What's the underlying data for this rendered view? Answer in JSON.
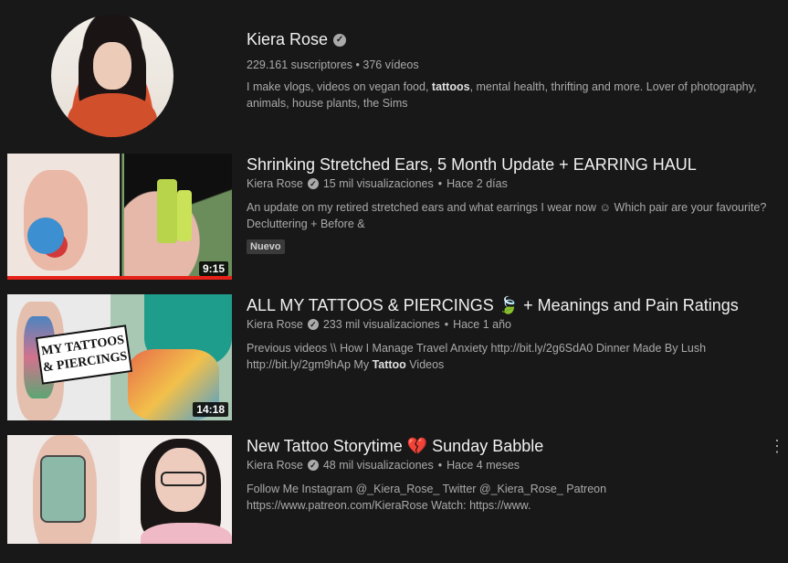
{
  "channel": {
    "name": "Kiera Rose",
    "subscribers": "229.161 suscriptores",
    "separator": "•",
    "videos": "376 vídeos",
    "description_pre": "I make vlogs, videos on vegan food, ",
    "description_bold": "tattoos",
    "description_post": ", mental health, thrifting and more. Lover of photography, animals, house plants, the Sims"
  },
  "videos": [
    {
      "title": "Shrinking Stretched Ears, 5 Month Update + EARRING HAUL",
      "channel": "Kiera Rose",
      "views": "15 mil visualizaciones",
      "age": "Hace 2 días",
      "description": "An update on my retired stretched ears and what earrings I wear now ☺ Which pair are your favourite? Decluttering + Before &",
      "badge": "Nuevo",
      "duration": "9:15",
      "watched_progress": 1.0
    },
    {
      "title": "ALL MY TATTOOS & PIERCINGS 🍃 + Meanings and Pain Ratings",
      "channel": "Kiera Rose",
      "views": "233 mil visualizaciones",
      "age": "Hace 1 año",
      "description_pre": "Previous videos \\\\ How I Manage Travel Anxiety http://bit.ly/2g6SdA0 Dinner Made By Lush http://bit.ly/2gm9hAp My ",
      "description_bold": "Tattoo",
      "description_post": " Videos",
      "thumb_text": "MY TATTOOS & PIERCINGS",
      "duration": "14:18"
    },
    {
      "title": "New Tattoo Storytime 💔 Sunday Babble",
      "channel": "Kiera Rose",
      "views": "48 mil visualizaciones",
      "age": "Hace 4 meses",
      "description": "Follow Me Instagram @_Kiera_Rose_ Twitter @_Kiera_Rose_ Patreon https://www.patreon.com/KieraRose Watch: https://www.",
      "menu_icon": "⋮"
    }
  ],
  "icons": {
    "verified": "✓"
  },
  "colors": {
    "background": "#181818",
    "progress": "#e62117",
    "text": "#f1f1f1",
    "secondary": "#aaaaaa"
  }
}
